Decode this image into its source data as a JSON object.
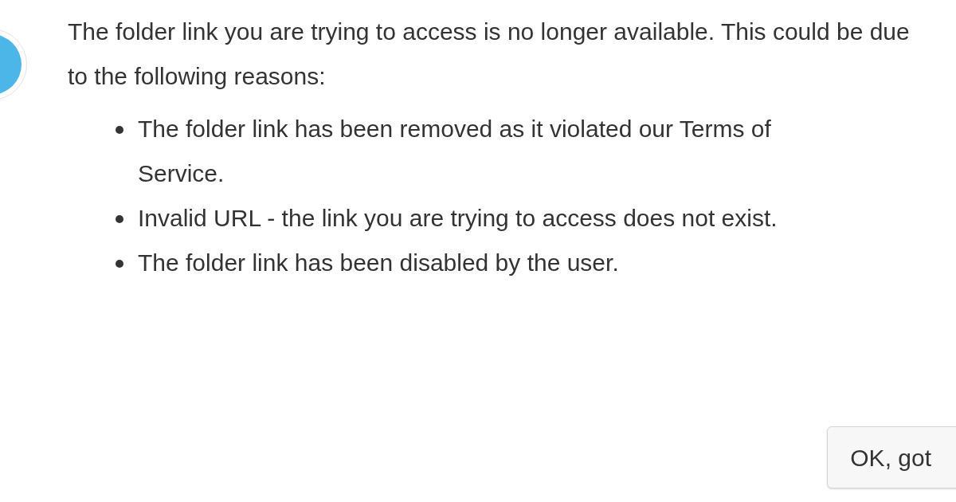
{
  "dialog": {
    "message": "The folder link you are trying to access is no longer available. This could be due to the following reasons:",
    "reasons": [
      "The folder link has been removed as it violated our Terms of Service.",
      "Invalid URL - the link you are trying to access does not exist.",
      "The folder link has been disabled by the user."
    ],
    "buttons": [
      "OK, got"
    ]
  }
}
